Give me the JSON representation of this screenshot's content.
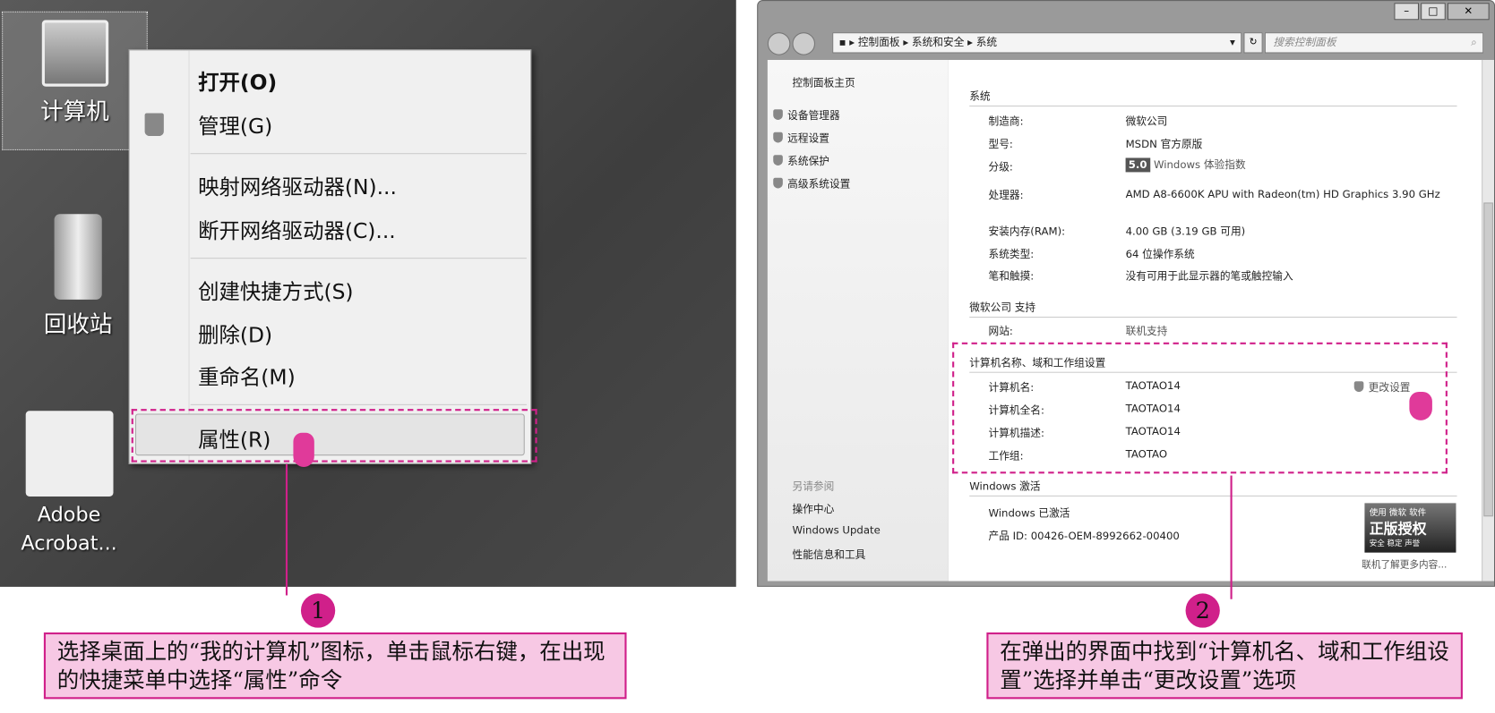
{
  "desktop": {
    "icons": [
      {
        "label": "计算机"
      },
      {
        "label": "回收站"
      },
      {
        "label": "Adobe Acrobat..."
      }
    ]
  },
  "context_menu": {
    "items": [
      "打开(O)",
      "管理(G)",
      "映射网络驱动器(N)...",
      "断开网络驱动器(C)...",
      "创建快捷方式(S)",
      "删除(D)",
      "重命名(M)",
      "属性(R)"
    ]
  },
  "window": {
    "breadcrumb": [
      "控制面板",
      "系统和安全",
      "系统"
    ],
    "search_placeholder": "搜索控制面板",
    "left_panel": {
      "home": "控制面板主页",
      "links": [
        "设备管理器",
        "远程设置",
        "系统保护",
        "高级系统设置"
      ],
      "see_also": "另请参阅",
      "see_also_links": [
        "操作中心",
        "Windows Update",
        "性能信息和工具"
      ]
    },
    "system": {
      "heading": "系统",
      "rows": [
        [
          "制造商:",
          "微软公司"
        ],
        [
          "型号:",
          "MSDN 官方原版"
        ],
        [
          "分级:",
          "Windows 体验指数"
        ],
        [
          "处理器:",
          "AMD A8-6600K APU with Radeon(tm) HD Graphics     3.90 GHz"
        ],
        [
          "安装内存(RAM):",
          "4.00 GB (3.19 GB 可用)"
        ],
        [
          "系统类型:",
          "64 位操作系统"
        ],
        [
          "笔和触摸:",
          "没有可用于此显示器的笔或触控输入"
        ]
      ],
      "rating": "5.0"
    },
    "support": {
      "heading": "微软公司 支持",
      "rows": [
        [
          "网站:",
          "联机支持"
        ]
      ]
    },
    "computer": {
      "heading": "计算机名称、域和工作组设置",
      "change": "更改设置",
      "rows": [
        [
          "计算机名:",
          "TAOTAO14"
        ],
        [
          "计算机全名:",
          "TAOTAO14"
        ],
        [
          "计算机描述:",
          "TAOTAO14"
        ],
        [
          "工作组:",
          "TAOTAO"
        ]
      ]
    },
    "activation": {
      "heading": "Windows 激活",
      "status": "Windows 已激活",
      "product_id": "产品 ID: 00426-OEM-8992662-00400",
      "badge_top": "使用 微软 软件",
      "badge_main": "正版授权",
      "badge_sub": "安全 稳定 声誉",
      "more": "联机了解更多内容..."
    }
  },
  "annotations": [
    {
      "num": "1",
      "text": "选择桌面上的“我的计算机”图标，单击鼠标右键，在出现的快捷菜单中选择“属性”命令"
    },
    {
      "num": "2",
      "text": "在弹出的界面中找到“计算机名、域和工作组设置”选择并单击“更改设置”选项"
    }
  ]
}
